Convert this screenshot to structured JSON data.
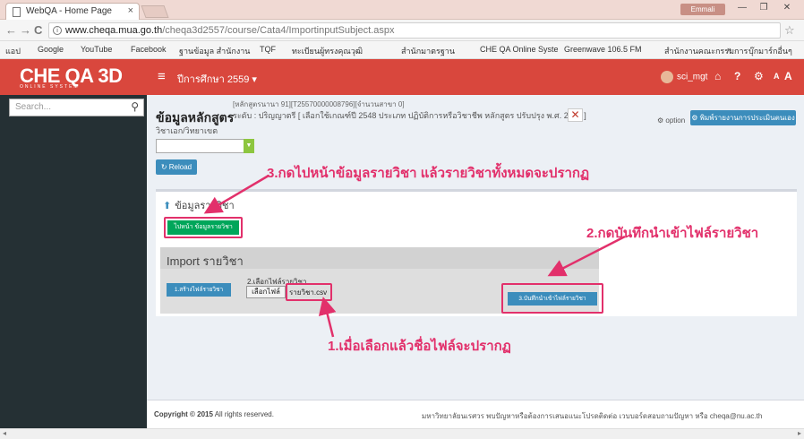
{
  "browser": {
    "tab_title": "WebQA - Home Page",
    "tab_close": "×",
    "profile_label": "Emmali",
    "win_min": "—",
    "win_max": "❐",
    "win_close": "✕",
    "url_host": "www.cheqa.mua.go.th",
    "url_path": "/cheqa3d2557/course/Cata4/ImportinputSubject.aspx",
    "back": "←",
    "forward": "→",
    "reload": "C",
    "star": "☆",
    "bookmarks": [
      "แอป",
      "Google",
      "YouTube",
      "Facebook",
      "ฐานข้อมูล สำนักงาน",
      "TQF",
      "ทะเบียนผู้ทรงคุณวุฒิ",
      "สำนักมาตรฐาน",
      "CHE QA Online Syste",
      "Greenwave 106.5 FM",
      "สำนักงานคณะกรรมการ",
      "»",
      "บุ๊กมาร์กอื่นๆ"
    ]
  },
  "app": {
    "logo": "CHE QA 3D",
    "logo_sub": "ONLINE SYSTEM",
    "menu_icon": "≡",
    "academic_year": "ปีการศึกษา 2559 ▾",
    "username": "sci_mgt",
    "top_icons": [
      "home-icon",
      "help-icon",
      "settings-icon",
      "font-decrease-icon",
      "font-increase-icon",
      "logout-icon"
    ],
    "top_icon_glyphs": [
      "⌂",
      "?",
      "⚙",
      "A",
      "A",
      "➜"
    ]
  },
  "sidebar": {
    "search_placeholder": "Search...",
    "search_icon": "🔍"
  },
  "page": {
    "title": "ข้อมูลหลักสูตร",
    "meta_line1": "[หลักสูตรนานา 91][T25570000008796][จำนวนสาขา 0]",
    "meta_line2": "ระดับ : ปริญญาตรี [ เลือกใช้เกณฑ์ปี 2548 ประเภท ปฏิบัติการหรือวิชาชีพ หลักสูตร ปรับปรุง พ.ศ. 2557 ]",
    "remove_glyph": "✕",
    "subtitle": "วิชาเอก/วิทยาเขต",
    "option_label": "option",
    "report_button": "พิมพ์รายงานการประเมินตนเอง",
    "reload_button": "Reload"
  },
  "subject_box": {
    "title": "ข้อมูลรายวิชา",
    "goto_button": "ไปหน้า ข้อมูลรายวิชา",
    "import_title": "Import รายวิชา",
    "create_button": "1.สร้างไฟล์รายวิชา",
    "step2_label": "2.เลือกไฟล์รายวิชา",
    "choose_file_button": "เลือกไฟล์",
    "file_name": "รายวิชา.csv",
    "save_button": "3.บันทึกนำเข้าไฟล์รายวิชา"
  },
  "footer": {
    "copyright_bold": "Copyright © 2015",
    "copyright_rest": " All rights reserved.",
    "note": "มหาวิทยาลัยนเรศวร พบปัญหาหรือต้องการเสนอแนะโปรดติดต่อ เวบบอร์ดสอบถามปัญหา หรือ cheqa@nu.ac.th"
  },
  "annotations": {
    "step1": "1.เมื่อเลือกแล้วชื่อไฟล์จะปรากฏ",
    "step2": "2.กดบันทึกนำเข้าไฟล์รายวิชา",
    "step3": "3.กดไปหน้าข้อมูลรายวิชา แล้วรายวิชาทั้งหมดจะปรากฏ"
  },
  "colors": {
    "brand_red": "#d9473d",
    "annotation_pink": "#e2306b",
    "primary_blue": "#3c8dbc",
    "success_green": "#00a65a",
    "sidebar_dark": "#253034"
  }
}
